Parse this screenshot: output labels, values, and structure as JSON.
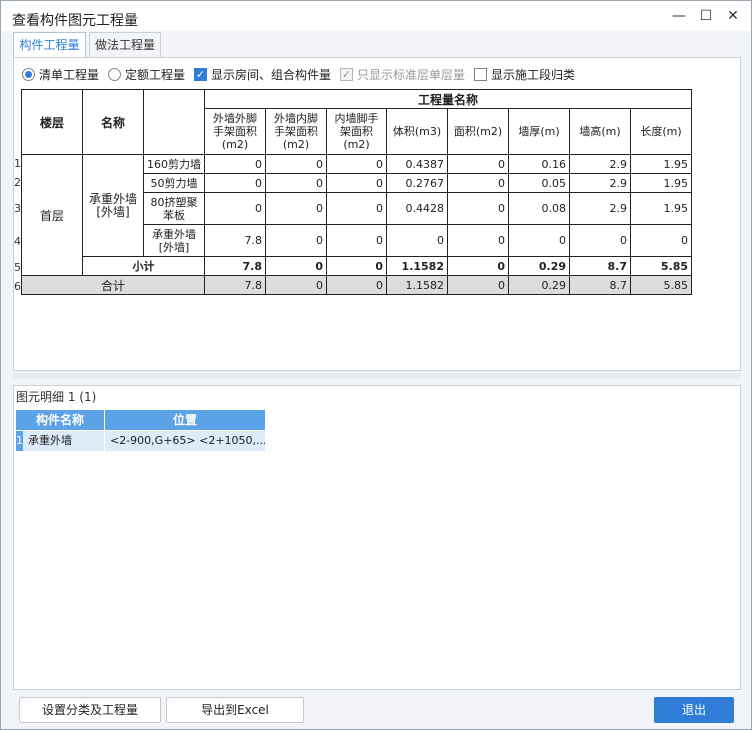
{
  "window": {
    "title": "查看构件图元工程量",
    "minimize": "—",
    "maximize": "☐",
    "close": "✕"
  },
  "tabs": [
    {
      "label": "构件工程量"
    },
    {
      "label": "做法工程量"
    }
  ],
  "options": {
    "qingdan": "清单工程量",
    "dinge": "定额工程量",
    "show_rooms": "显示房间、组合构件量",
    "std_floor_only": "只显示标准层单层量",
    "show_segments": "显示施工段归类"
  },
  "table": {
    "col_floor": "楼层",
    "col_name": "名称",
    "group_header": "工程量名称",
    "subheaders": [
      "外墙外脚手架面积(m2)",
      "外墙内脚手架面积(m2)",
      "内墙脚手架面积(m2)",
      "体积(m3)",
      "面积(m2)",
      "墙厚(m)",
      "墙高(m)",
      "长度(m)"
    ],
    "floor_value": "首层",
    "name_value": "承重外墙[外墙]",
    "rows": [
      {
        "num": "1",
        "item": "160剪力墙",
        "v": [
          "0",
          "0",
          "0",
          "0.4387",
          "0",
          "0.16",
          "2.9",
          "1.95"
        ]
      },
      {
        "num": "2",
        "item": "50剪力墙",
        "v": [
          "0",
          "0",
          "0",
          "0.2767",
          "0",
          "0.05",
          "2.9",
          "1.95"
        ]
      },
      {
        "num": "3",
        "item": "80挤塑聚苯板",
        "v": [
          "0",
          "0",
          "0",
          "0.4428",
          "0",
          "0.08",
          "2.9",
          "1.95"
        ]
      },
      {
        "num": "4",
        "item": "承重外墙[外墙]",
        "v": [
          "7.8",
          "0",
          "0",
          "0",
          "0",
          "0",
          "0",
          "0"
        ]
      }
    ],
    "subtotal": {
      "num": "5",
      "label": "小计",
      "v": [
        "7.8",
        "0",
        "0",
        "1.1582",
        "0",
        "0.29",
        "8.7",
        "5.85"
      ]
    },
    "total": {
      "num": "6",
      "label": "合计",
      "v": [
        "7.8",
        "0",
        "0",
        "1.1582",
        "0",
        "0.29",
        "8.7",
        "5.85"
      ]
    }
  },
  "detail": {
    "label": "图元明细  1 (1)",
    "headers": [
      "构件名称",
      "位置"
    ],
    "row_num": "1",
    "row": [
      "承重外墙",
      "<2-900,G+65> <2+1050,..."
    ]
  },
  "buttons": {
    "settings": "设置分类及工程量",
    "export": "导出到Excel",
    "exit": "退出"
  },
  "colors": {
    "accent": "#2f7dd8",
    "grid_header": "#5ba3e6"
  }
}
